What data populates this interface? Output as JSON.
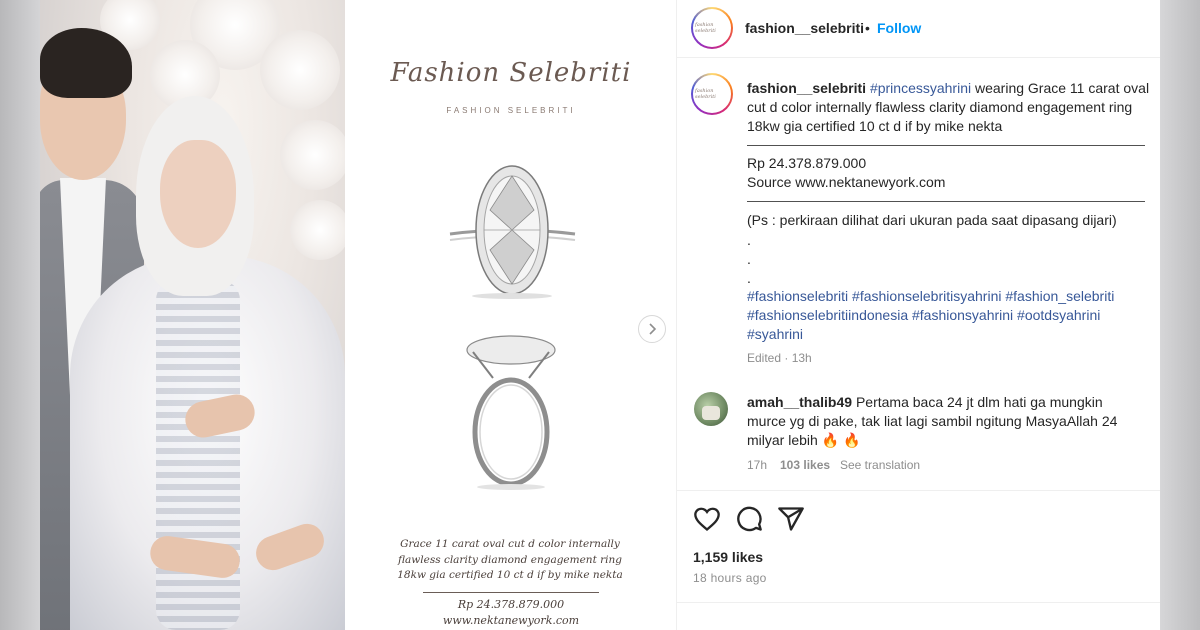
{
  "post": {
    "brand_script": "Fashion Selebriti",
    "brand_small": "FASHION SELEBRITI",
    "caption_image_lines": [
      "Grace 11 carat oval cut d color internally",
      "flawless clarity diamond engagement ring",
      "18kw gia certified 10 ct d if by mike nekta"
    ],
    "caption_image_price": "Rp 24.378.879.000",
    "caption_image_source": "www.nektanewyork.com"
  },
  "header": {
    "username": "fashion__selebriti",
    "separator": "•",
    "follow_label": "Follow"
  },
  "caption": {
    "username": "fashion__selebriti",
    "mention": "#princessyahrini",
    "line1_rest": " wearing Grace 11 carat oval",
    "line2": "cut d color internally flawless clarity diamond engagement ring",
    "line3": "18kw gia certified 10 ct d if by mike nekta",
    "price": "Rp 24.378.879.000",
    "source": "Source www.nektanewyork.com",
    "note": "(Ps : perkiraan dilihat dari ukuran pada saat dipasang dijari)",
    "dot1": ".",
    "dot2": ".",
    "dot3": ".",
    "tags_line1": "#fashionselebriti #fashionselebritisyahrini #fashion_selebriti",
    "tags_line2": "#fashionselebritiindonesia #fashionsyahrini #ootdsyahrini",
    "tags_line3": "#syahrini",
    "edited": "Edited · 13h"
  },
  "comment": {
    "username": "amah__thalib49",
    "line1_rest": " Pertama baca 24 jt dlm hati ga mungkin",
    "line2": "murce yg di pake, tak liat lagi sambil ngitung MasyaAllah 24",
    "line3": "milyar lebih 🔥 🔥",
    "time": "17h",
    "likes": "103 likes",
    "translate": "See translation"
  },
  "footer": {
    "like_count": "1,159 likes",
    "time_ago": "18 hours ago"
  },
  "icons": {
    "like": "heart-icon",
    "comment": "comment-icon",
    "share": "share-icon",
    "next": "chevron-right-icon"
  },
  "colors": {
    "link": "#0095f6",
    "hashtag": "#385898",
    "text": "#262626",
    "muted": "#8e8e8e"
  }
}
